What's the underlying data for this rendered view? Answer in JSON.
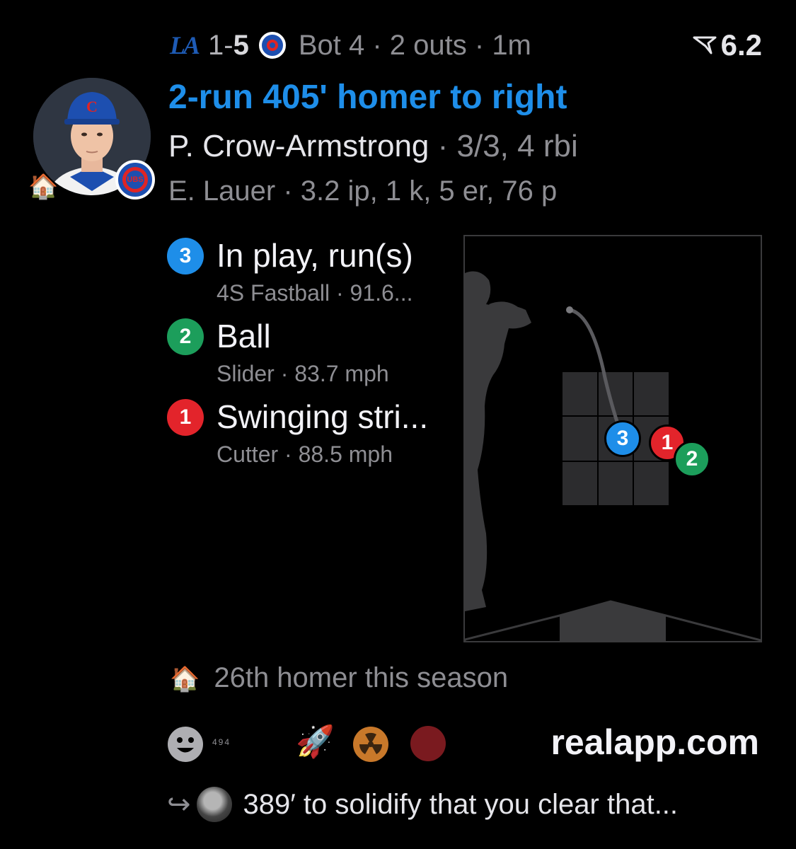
{
  "header": {
    "away_score": "1",
    "home_score": "5",
    "separator": "-",
    "inning": "Bot 4",
    "outs": "2 outs",
    "time_ago": "1m",
    "rating": "6.2"
  },
  "play": {
    "title": "2-run 405' homer to right",
    "batter_name": "P. Crow-Armstrong",
    "batter_stats": "· 3/3, 4 rbi",
    "pitcher_line": "E. Lauer · 3.2 ip, 1 k, 5 er, 76 p"
  },
  "pitches": [
    {
      "number": "3",
      "result": "In play, run(s)",
      "detail": "4S Fastball · 91.6...",
      "color": "#1e8ee9"
    },
    {
      "number": "2",
      "result": "Ball",
      "detail": "Slider · 83.7 mph",
      "color": "#1c9e5b"
    },
    {
      "number": "1",
      "result": "Swinging stri...",
      "detail": "Cutter · 88.5 mph",
      "color": "#e3242b"
    }
  ],
  "note": "26th homer this season",
  "reactions": {
    "count": "494",
    "domain": "realapp.com"
  },
  "reply": {
    "text": "389′ to solidify that you clear that..."
  },
  "colors": {
    "accent": "#1e8ee9",
    "muted": "#8e8e93",
    "cubs_blue": "#1d4fb0",
    "cubs_red": "#e02424"
  },
  "icons": [
    "dodgers-logo-icon",
    "cubs-logo-icon",
    "rating-flag-icon",
    "house-icon",
    "smiley-icon",
    "rocket-icon",
    "radioactive-icon",
    "reply-arrow-icon"
  ]
}
